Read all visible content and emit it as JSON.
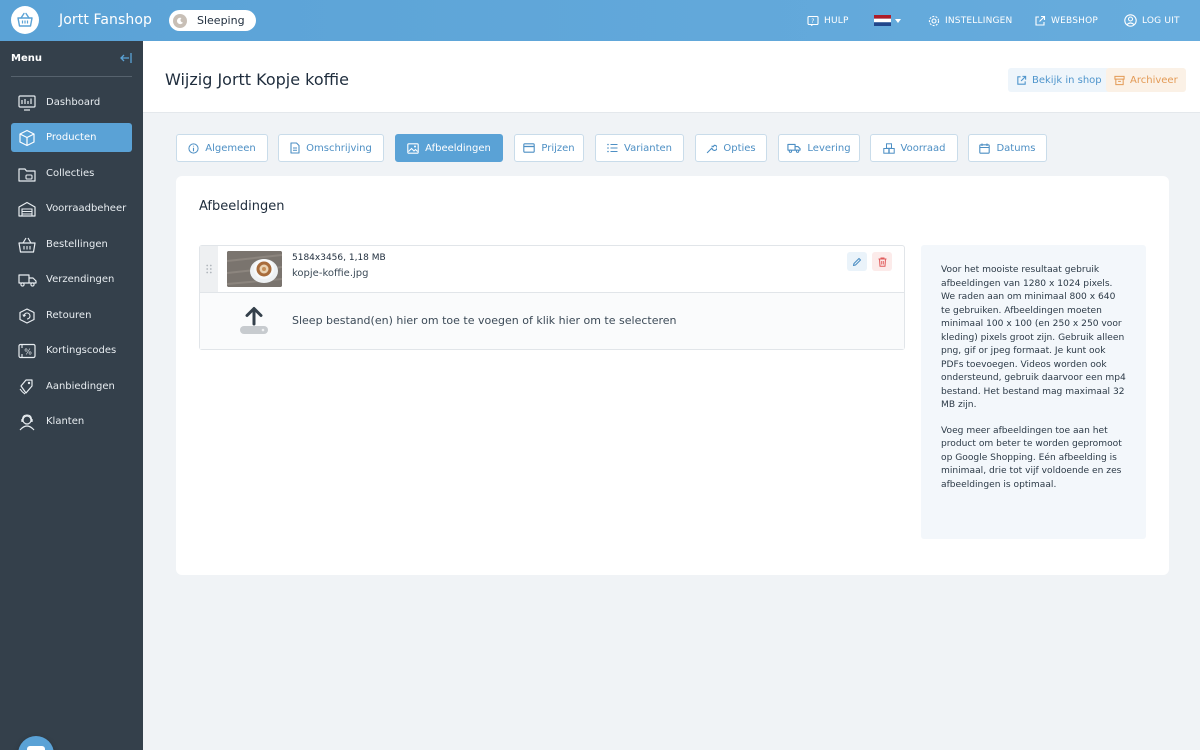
{
  "topbar": {
    "app_title": "Jortt Fanshop",
    "status_label": "Sleeping",
    "help_label": "HULP",
    "language_flag": "nl-flag",
    "settings_label": "INSTELLINGEN",
    "webshop_label": "WEBSHOP",
    "logout_label": "LOG UIT"
  },
  "sidebar": {
    "menu_title": "Menu",
    "items": [
      {
        "label": "Dashboard",
        "icon": "dashboard-icon"
      },
      {
        "label": "Producten",
        "icon": "box-icon",
        "active": true
      },
      {
        "label": "Collecties",
        "icon": "collection-icon"
      },
      {
        "label": "Voorraadbeheer",
        "icon": "warehouse-icon"
      },
      {
        "label": "Bestellingen",
        "icon": "basket-icon"
      },
      {
        "label": "Verzendingen",
        "icon": "truck-icon"
      },
      {
        "label": "Retouren",
        "icon": "return-icon"
      },
      {
        "label": "Kortingscodes",
        "icon": "discount-icon"
      },
      {
        "label": "Aanbiedingen",
        "icon": "offer-icon"
      },
      {
        "label": "Klanten",
        "icon": "customer-icon"
      }
    ]
  },
  "header": {
    "title": "Wijzig Jortt Kopje koffie",
    "view_in_shop_label": "Bekijk in shop",
    "archive_label": "Archiveer"
  },
  "tabs": [
    {
      "label": "Algemeen",
      "icon": "info-icon"
    },
    {
      "label": "Omschrijving",
      "icon": "document-icon"
    },
    {
      "label": "Afbeeldingen",
      "icon": "image-icon",
      "active": true
    },
    {
      "label": "Prijzen",
      "icon": "card-icon"
    },
    {
      "label": "Varianten",
      "icon": "list-icon"
    },
    {
      "label": "Opties",
      "icon": "wrench-icon"
    },
    {
      "label": "Levering",
      "icon": "truck-icon"
    },
    {
      "label": "Voorraad",
      "icon": "boxes-icon"
    },
    {
      "label": "Datums",
      "icon": "calendar-icon"
    }
  ],
  "images_section": {
    "title": "Afbeeldingen",
    "file": {
      "meta": "5184x3456, 1,18 MB",
      "name": "kopje-koffie.jpg"
    },
    "drop_text": "Sleep bestand(en) hier om toe te voegen of klik hier om te selecteren",
    "info_paragraphs": [
      "Voor het mooiste resultaat gebruik afbeeldingen van 1280 x 1024 pixels. We raden aan om minimaal 800 x 640 te gebruiken. Afbeeldingen moeten minimaal 100 x 100 (en 250 x 250 voor kleding) pixels groot zijn. Gebruik alleen png, gif or jpeg formaat. Je kunt ook PDFs toevoegen. Videos worden ook ondersteund, gebruik daarvoor een mp4 bestand. Het bestand mag maximaal 32 MB zijn.",
      "Voeg meer afbeeldingen toe aan het product om beter te worden gepromoot op Google Shopping. Eén afbeelding is minimaal, drie tot vijf voldoende en zes afbeeldingen is optimaal."
    ]
  },
  "colors": {
    "accent": "#5aa2d6",
    "sidebar_bg": "#34404b",
    "archive": "#e39a55",
    "danger": "#e05a5a"
  }
}
